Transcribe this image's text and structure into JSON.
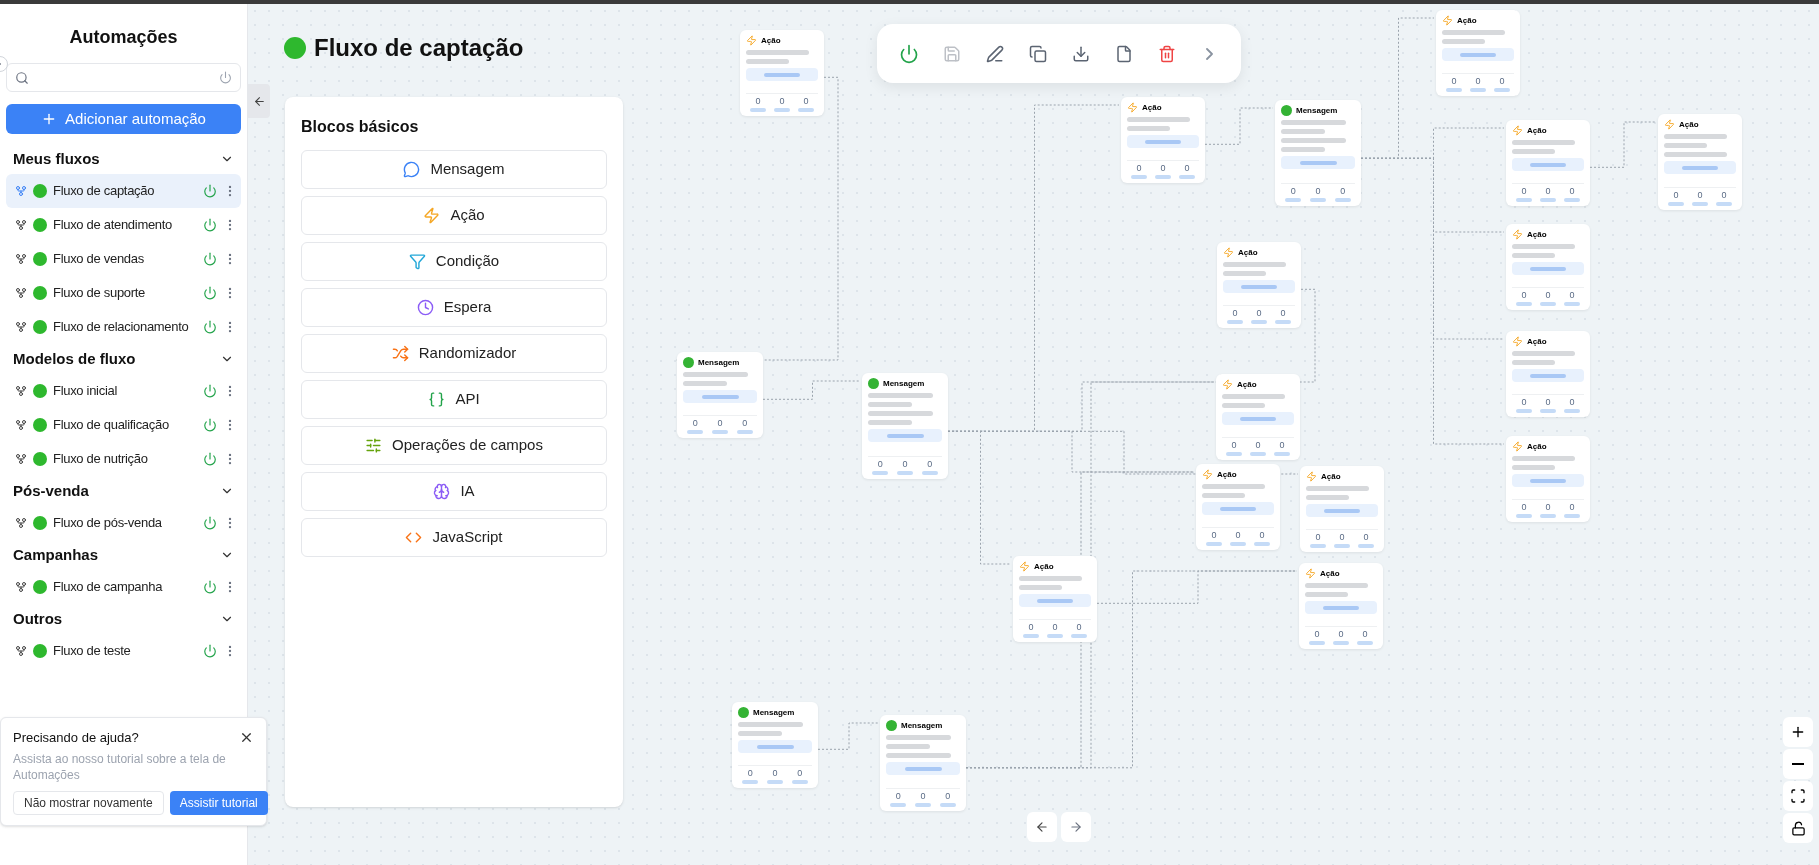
{
  "sidebar": {
    "title": "Automações",
    "add_button": "Adicionar automação",
    "groups": [
      {
        "title": "Meus fluxos",
        "expanded": true,
        "items": [
          {
            "name": "Fluxo de captação",
            "selected": true,
            "on": true
          },
          {
            "name": "Fluxo de atendimento",
            "selected": false,
            "on": true
          },
          {
            "name": "Fluxo de vendas",
            "selected": false,
            "on": true
          },
          {
            "name": "Fluxo de suporte",
            "selected": false,
            "on": true
          },
          {
            "name": "Fluxo de relacionamento",
            "selected": false,
            "on": true
          }
        ]
      },
      {
        "title": "Modelos de fluxo",
        "expanded": true,
        "items": [
          {
            "name": "Fluxo inicial",
            "selected": false,
            "on": true
          },
          {
            "name": "Fluxo de qualificação",
            "selected": false,
            "on": true
          },
          {
            "name": "Fluxo de nutrição",
            "selected": false,
            "on": true
          }
        ]
      },
      {
        "title": "Pós-venda",
        "expanded": true,
        "items": [
          {
            "name": "Fluxo de pós-venda",
            "selected": false,
            "on": true
          }
        ]
      },
      {
        "title": "Campanhas",
        "expanded": true,
        "items": [
          {
            "name": "Fluxo de campanha",
            "selected": false,
            "on": true
          }
        ]
      },
      {
        "title": "Outros",
        "expanded": true,
        "items": [
          {
            "name": "Fluxo de teste",
            "selected": false,
            "on": true
          }
        ]
      }
    ]
  },
  "help": {
    "title": "Precisando de ajuda?",
    "text": "Assista ao nosso tutorial sobre a tela de Automações",
    "buttons": [
      "Não mostrar novamente",
      "Assistir tutorial"
    ]
  },
  "flow": {
    "title": "Fluxo de captação",
    "on": true
  },
  "toolbar": [
    {
      "kind": "power",
      "disabled": false
    },
    {
      "kind": "save",
      "disabled": true
    },
    {
      "kind": "edit",
      "disabled": false
    },
    {
      "kind": "copy",
      "disabled": false
    },
    {
      "kind": "download",
      "disabled": false
    },
    {
      "kind": "file",
      "disabled": false
    },
    {
      "kind": "delete",
      "disabled": false
    },
    {
      "kind": "more",
      "disabled": false
    }
  ],
  "palette": {
    "title": "Blocos básicos",
    "blocks": [
      {
        "kind": "message",
        "label": "Mensagem"
      },
      {
        "kind": "action",
        "label": "Ação"
      },
      {
        "kind": "condition",
        "label": "Condição"
      },
      {
        "kind": "wait",
        "label": "Espera"
      },
      {
        "kind": "randomizer",
        "label": "Randomizador"
      },
      {
        "kind": "api",
        "label": "API"
      },
      {
        "kind": "fields",
        "label": "Operações de campos"
      },
      {
        "kind": "ai",
        "label": "IA"
      },
      {
        "kind": "javascript",
        "label": "JavaScript"
      }
    ]
  },
  "nodes": [
    {
      "kind": "action",
      "title": "Ação",
      "stats": [
        "0",
        "0",
        "0"
      ]
    },
    {
      "kind": "action",
      "title": "Ação",
      "stats": [
        "0",
        "0",
        "0"
      ]
    },
    {
      "kind": "message",
      "title": "Mensagem",
      "stats": [
        "0",
        "0",
        "0"
      ]
    },
    {
      "kind": "action",
      "title": "Ação",
      "stats": [
        "0",
        "0",
        "0"
      ]
    },
    {
      "kind": "action",
      "title": "Ação",
      "stats": [
        "0",
        "0",
        "0"
      ]
    },
    {
      "kind": "action",
      "title": "Ação",
      "stats": [
        "0",
        "0",
        "0"
      ]
    },
    {
      "kind": "action",
      "title": "Ação",
      "stats": [
        "0",
        "0",
        "0"
      ]
    },
    {
      "kind": "action",
      "title": "Ação",
      "stats": [
        "0",
        "0",
        "0"
      ]
    },
    {
      "kind": "action",
      "title": "Ação",
      "stats": [
        "0",
        "0",
        "0"
      ]
    },
    {
      "kind": "action",
      "title": "Ação",
      "stats": [
        "0",
        "0",
        "0"
      ]
    },
    {
      "kind": "message",
      "title": "Mensagem",
      "stats": [
        "0",
        "0",
        "0"
      ]
    },
    {
      "kind": "message",
      "title": "Mensagem",
      "stats": [
        "0",
        "0",
        "0"
      ]
    },
    {
      "kind": "action",
      "title": "Ação",
      "stats": [
        "0",
        "0",
        "0"
      ]
    },
    {
      "kind": "action",
      "title": "Ação",
      "stats": [
        "0",
        "0",
        "0"
      ]
    },
    {
      "kind": "action",
      "title": "Ação",
      "stats": [
        "0",
        "0",
        "0"
      ]
    },
    {
      "kind": "action",
      "title": "Ação",
      "stats": [
        "0",
        "0",
        "0"
      ]
    },
    {
      "kind": "action",
      "title": "Ação",
      "stats": [
        "0",
        "0",
        "0"
      ]
    },
    {
      "kind": "message",
      "title": "Mensagem",
      "stats": [
        "0",
        "0",
        "0"
      ]
    },
    {
      "kind": "message",
      "title": "Mensagem",
      "stats": [
        "0",
        "0",
        "0"
      ]
    }
  ]
}
